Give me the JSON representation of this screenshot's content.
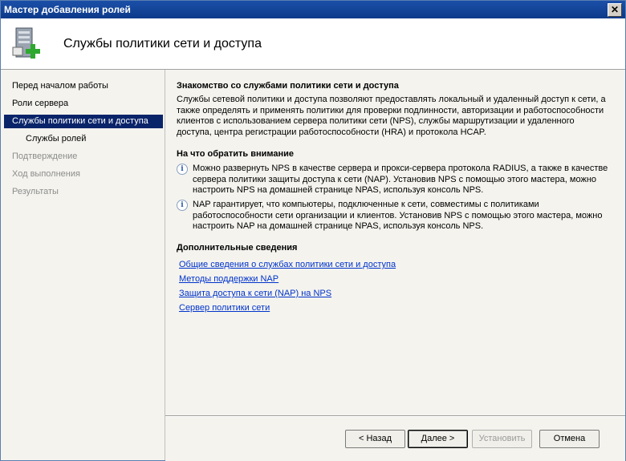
{
  "window": {
    "title": "Мастер добавления ролей",
    "close_symbol": "✕"
  },
  "header": {
    "title": "Службы политики сети и доступа",
    "icon": "server-add-icon"
  },
  "sidebar": {
    "items": [
      {
        "label": "Перед началом работы",
        "state": "normal"
      },
      {
        "label": "Роли сервера",
        "state": "normal"
      },
      {
        "label": "Службы политики сети и доступа",
        "state": "active"
      },
      {
        "label": "Службы ролей",
        "state": "sub"
      },
      {
        "label": "Подтверждение",
        "state": "disabled"
      },
      {
        "label": "Ход выполнения",
        "state": "disabled"
      },
      {
        "label": "Результаты",
        "state": "disabled"
      }
    ]
  },
  "main": {
    "intro_heading": "Знакомство со службами политики сети и доступа",
    "intro_text": "Службы сетевой политики и доступа позволяют предоставлять локальный и удаленный доступ к сети, а также определять и применять политики для проверки подлинности, авторизации и работоспособности клиентов с использованием сервера политики сети (NPS), службы маршрутизации и удаленного доступа, центра регистрации работоспособности (HRA) и протокола HCAP.",
    "notes_heading": "На что обратить внимание",
    "notes": [
      "Можно развернуть NPS в качестве сервера и прокси-сервера протокола RADIUS, а также в качестве сервера политики защиты доступа к сети (NAP). Установив NPS с помощью этого мастера, можно настроить NPS на домашней странице NPAS, используя консоль NPS.",
      "NAP гарантирует, что компьютеры, подключенные к сети, совместимы с политиками работоспособности сети организации и клиентов. Установив NPS с помощью этого мастера, можно настроить NAP на домашней странице NPAS, используя консоль NPS."
    ],
    "more_heading": "Дополнительные сведения",
    "links": [
      "Общие сведения о службах политики сети и доступа",
      "Методы поддержки NAP",
      "Защита доступа к сети (NAP) на NPS",
      "Сервер политики сети"
    ]
  },
  "footer": {
    "back": "< Назад",
    "next": "Далее >",
    "install": "Установить",
    "cancel": "Отмена"
  }
}
